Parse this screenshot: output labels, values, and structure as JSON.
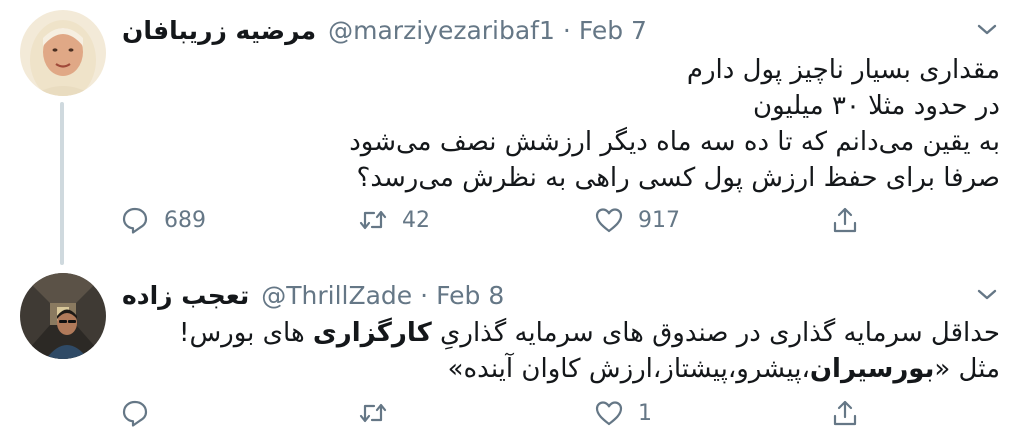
{
  "tweets": [
    {
      "display_name": "مرضیه زریبافان",
      "handle": "@marziyezaribaf1",
      "separator": "·",
      "date": "Feb 7",
      "lines": [
        "مقداری بسیار ناچیز پول دارم",
        "در حدود مثلا ۳۰ میلیون",
        "به یقین می‌دانم که تا ده سه ماه دیگر ارزشش نصف می‌شود",
        "صرفا برای حفظ ارزش پول کسی راهی به نظرش می‌رسد؟"
      ],
      "actions": {
        "reply_count": "689",
        "retweet_count": "42",
        "like_count": "917"
      },
      "avatar_icon": "woman-in-hijab-avatar"
    },
    {
      "display_name": "تعجب زاده",
      "handle": "@ThrillZade",
      "separator": "·",
      "date": "Feb 8",
      "line1": {
        "part_a": "حداقل سرمایه گذاری در صندوق های سرمایه گذاریِ ",
        "bold": "کارگزاری",
        "part_b": " های بورس!"
      },
      "line2": {
        "part_a": "مثل «",
        "bold": "بورسیران",
        "part_b": "،پیشرو،پیشتاز،ارزش کاوان آینده»"
      },
      "actions": {
        "reply_count": "",
        "retweet_count": "",
        "like_count": "1"
      },
      "avatar_icon": "man-in-corridor-avatar"
    }
  ],
  "icons": [
    "reply-icon",
    "retweet-icon",
    "like-icon",
    "share-icon",
    "chevron-down-icon"
  ],
  "colors": {
    "text": "#14171a",
    "secondary": "#657786",
    "thread_line": "#cfd9de",
    "background": "#ffffff"
  }
}
